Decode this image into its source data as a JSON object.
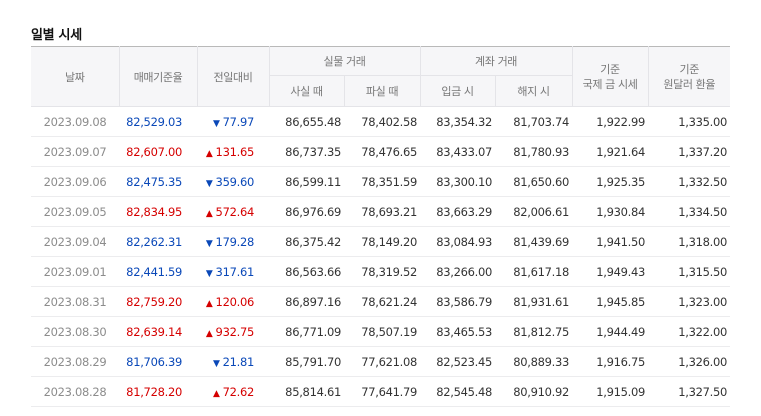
{
  "title": "일별 시세",
  "colors": {
    "up": "#d50000",
    "down": "#0a48b8"
  },
  "header": {
    "date": "날짜",
    "base_rate": "매매기준율",
    "change": "전일대비",
    "physical_trade": "실물 거래",
    "buy": "사실 때",
    "sell": "파실 때",
    "account_trade": "계좌 거래",
    "deposit": "입금 시",
    "withdraw": "해지 시",
    "intl_gold_line1": "기준",
    "intl_gold_line2": "국제 금 시세",
    "krw_usd_line1": "기준",
    "krw_usd_line2": "원달러 환율"
  },
  "rows": [
    {
      "date": "2023.09.08",
      "rate": "82,529.03",
      "dir": "down",
      "arrow": "▼",
      "change": "77.97",
      "buy": "86,655.48",
      "sell": "78,402.58",
      "deposit": "83,354.32",
      "withdraw": "81,703.74",
      "gold": "1,922.99",
      "usd": "1,335.00"
    },
    {
      "date": "2023.09.07",
      "rate": "82,607.00",
      "dir": "up",
      "arrow": "▲",
      "change": "131.65",
      "buy": "86,737.35",
      "sell": "78,476.65",
      "deposit": "83,433.07",
      "withdraw": "81,780.93",
      "gold": "1,921.64",
      "usd": "1,337.20"
    },
    {
      "date": "2023.09.06",
      "rate": "82,475.35",
      "dir": "down",
      "arrow": "▼",
      "change": "359.60",
      "buy": "86,599.11",
      "sell": "78,351.59",
      "deposit": "83,300.10",
      "withdraw": "81,650.60",
      "gold": "1,925.35",
      "usd": "1,332.50"
    },
    {
      "date": "2023.09.05",
      "rate": "82,834.95",
      "dir": "up",
      "arrow": "▲",
      "change": "572.64",
      "buy": "86,976.69",
      "sell": "78,693.21",
      "deposit": "83,663.29",
      "withdraw": "82,006.61",
      "gold": "1,930.84",
      "usd": "1,334.50"
    },
    {
      "date": "2023.09.04",
      "rate": "82,262.31",
      "dir": "down",
      "arrow": "▼",
      "change": "179.28",
      "buy": "86,375.42",
      "sell": "78,149.20",
      "deposit": "83,084.93",
      "withdraw": "81,439.69",
      "gold": "1,941.50",
      "usd": "1,318.00"
    },
    {
      "date": "2023.09.01",
      "rate": "82,441.59",
      "dir": "down",
      "arrow": "▼",
      "change": "317.61",
      "buy": "86,563.66",
      "sell": "78,319.52",
      "deposit": "83,266.00",
      "withdraw": "81,617.18",
      "gold": "1,949.43",
      "usd": "1,315.50"
    },
    {
      "date": "2023.08.31",
      "rate": "82,759.20",
      "dir": "up",
      "arrow": "▲",
      "change": "120.06",
      "buy": "86,897.16",
      "sell": "78,621.24",
      "deposit": "83,586.79",
      "withdraw": "81,931.61",
      "gold": "1,945.85",
      "usd": "1,323.00"
    },
    {
      "date": "2023.08.30",
      "rate": "82,639.14",
      "dir": "up",
      "arrow": "▲",
      "change": "932.75",
      "buy": "86,771.09",
      "sell": "78,507.19",
      "deposit": "83,465.53",
      "withdraw": "81,812.75",
      "gold": "1,944.49",
      "usd": "1,322.00"
    },
    {
      "date": "2023.08.29",
      "rate": "81,706.39",
      "dir": "down",
      "arrow": "▼",
      "change": "21.81",
      "buy": "85,791.70",
      "sell": "77,621.08",
      "deposit": "82,523.45",
      "withdraw": "80,889.33",
      "gold": "1,916.75",
      "usd": "1,326.00"
    },
    {
      "date": "2023.08.28",
      "rate": "81,728.20",
      "dir": "up",
      "arrow": "▲",
      "change": "72.62",
      "buy": "85,814.61",
      "sell": "77,641.79",
      "deposit": "82,545.48",
      "withdraw": "80,910.92",
      "gold": "1,915.09",
      "usd": "1,327.50"
    }
  ]
}
